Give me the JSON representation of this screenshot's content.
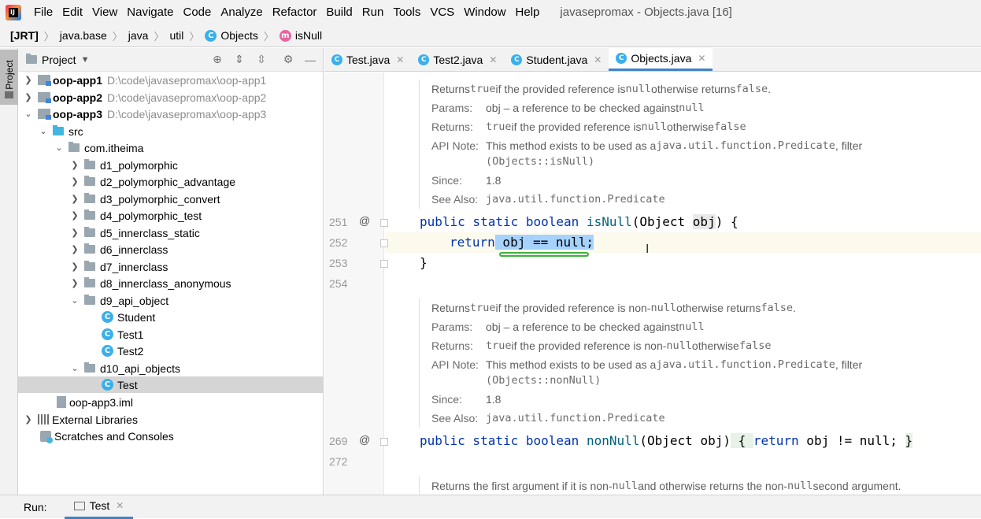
{
  "menu": {
    "logo_letters": "IJ",
    "items": [
      "File",
      "Edit",
      "View",
      "Navigate",
      "Code",
      "Analyze",
      "Refactor",
      "Build",
      "Run",
      "Tools",
      "VCS",
      "Window",
      "Help"
    ],
    "window_title": "javasepromax - Objects.java [16]"
  },
  "breadcrumb": {
    "items": [
      "[JRT]",
      "java.base",
      "java",
      "util",
      "Objects",
      "isNull"
    ]
  },
  "tool_strip": {
    "project_label": "Project"
  },
  "project_panel": {
    "title": "Project",
    "tree": [
      {
        "label": "oop-app1",
        "path": "D:\\code\\javasepromax\\oop-app1"
      },
      {
        "label": "oop-app2",
        "path": "D:\\code\\javasepromax\\oop-app2"
      },
      {
        "label": "oop-app3",
        "path": "D:\\code\\javasepromax\\oop-app3"
      },
      {
        "label": "src"
      },
      {
        "label": "com.itheima"
      },
      {
        "label": "d1_polymorphic"
      },
      {
        "label": "d2_polymorphic_advantage"
      },
      {
        "label": "d3_polymorphic_convert"
      },
      {
        "label": "d4_polymorphic_test"
      },
      {
        "label": "d5_innerclass_static"
      },
      {
        "label": "d6_innerclass"
      },
      {
        "label": "d7_innerclass"
      },
      {
        "label": "d8_innerclass_anonymous"
      },
      {
        "label": "d9_api_object"
      },
      {
        "label": "Student"
      },
      {
        "label": "Test1"
      },
      {
        "label": "Test2"
      },
      {
        "label": "d10_api_objects"
      },
      {
        "label": "Test"
      },
      {
        "label": "oop-app3.iml"
      },
      {
        "label": "External Libraries"
      },
      {
        "label": "Scratches and Consoles"
      }
    ]
  },
  "tabs": [
    {
      "label": "Test.java"
    },
    {
      "label": "Student.java"
    },
    {
      "label": "Test2.java"
    },
    {
      "label": "Objects.java"
    }
  ],
  "editor": {
    "line_numbers": [
      "251",
      "252",
      "253",
      "254",
      "269",
      "272"
    ],
    "doc1": {
      "summary_pre": "Returns ",
      "summary_true": "true",
      "summary_mid": " if the provided reference is ",
      "summary_null": "null",
      "summary_post": " otherwise returns ",
      "summary_false": "false",
      "summary_end": ".",
      "params_key": "Params:",
      "params_pre": "obj – a reference to be checked against ",
      "params_null": "null",
      "returns_key": "Returns:",
      "returns_true": "true",
      "returns_mid": " if the provided reference is ",
      "returns_null": "null",
      "returns_post": " otherwise ",
      "returns_false": "false",
      "api_key": "API Note:",
      "api_text": "This method exists to be used as a ",
      "api_link": "java.util.function.Predicate",
      "api_filter": ", filter",
      "api_ref": "(Objects::isNull)",
      "since_key": "Since:",
      "since_val": "1.8",
      "see_key": "See Also:",
      "see_link": "java.util.function.Predicate"
    },
    "code": {
      "l251_kw": "public static boolean",
      "l251_fn": "isNull",
      "l251_rest1": "(Object ",
      "l251_obj": "obj",
      "l251_rest2": ") {",
      "l252_kw": "return",
      "l252_sel": " obj == null;",
      "l253": "}",
      "l269_kw": "public static boolean",
      "l269_fn": "nonNull",
      "l269_rest": "(Object obj)",
      "l269_brace1": " { ",
      "l269_kw2": "return",
      "l269_rest2": " obj != null; ",
      "l269_brace2": "}"
    },
    "doc2": {
      "summary_pre": "Returns ",
      "summary_true": "true",
      "summary_mid": " if the provided reference is non-",
      "summary_null": "null",
      "summary_post": " otherwise returns ",
      "summary_false": "false",
      "summary_end": ".",
      "params_key": "Params:",
      "params_pre": "obj – a reference to be checked against ",
      "params_null": "null",
      "returns_key": "Returns:",
      "returns_true": "true",
      "returns_mid": " if the provided reference is non-",
      "returns_null": "null",
      "returns_post": " otherwise ",
      "returns_false": "false",
      "api_key": "API Note:",
      "api_text": "This method exists to be used as a ",
      "api_link": "java.util.function.Predicate",
      "api_filter": ", filter",
      "api_ref": "(Objects::nonNull)",
      "since_key": "Since:",
      "since_val": "1.8",
      "see_key": "See Also:",
      "see_link": "java.util.function.Predicate"
    },
    "doc3": {
      "pre": "Returns the first argument if it is non-",
      "null1": "null",
      "mid": " and otherwise returns the non-",
      "null2": "null",
      "post": " second argument."
    }
  },
  "bottom": {
    "run_label": "Run:",
    "run_tab": "Test"
  }
}
